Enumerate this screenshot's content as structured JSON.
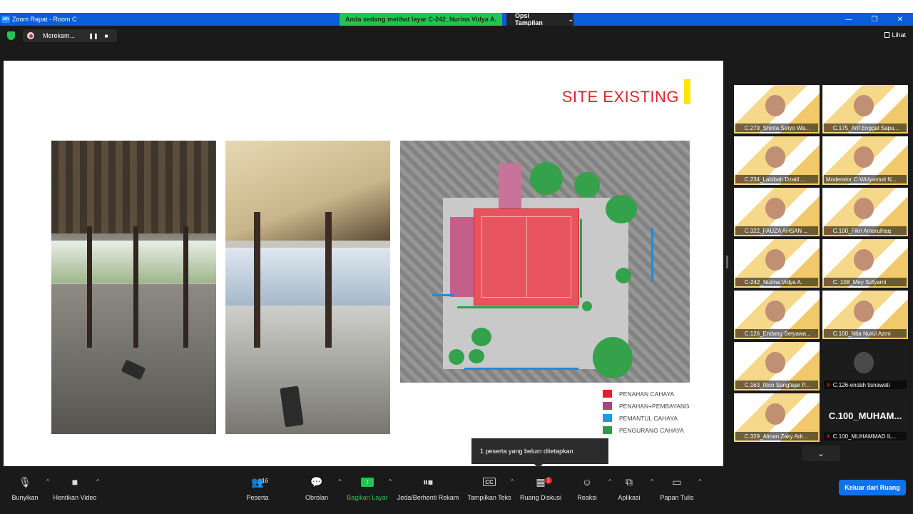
{
  "window": {
    "title": "Zoom Rapat - Room C",
    "logo_text": "zm"
  },
  "share_banner": "Anda sedang melihat layar C-242_Nurina Vidya A.",
  "view_options": {
    "label": "Opsi Tampilan",
    "caret": "⌄"
  },
  "recording": {
    "label": "Merekam...",
    "pause": "❚❚",
    "stop": "■"
  },
  "view_button": "Lihat",
  "slide": {
    "title": "SITE EXISTING",
    "legend": [
      {
        "label": "PENAHAN CAHAYA",
        "color": "#e0202a"
      },
      {
        "label": "PENAHAN+PEMBAYANG",
        "color": "#b0407e"
      },
      {
        "label": "PEMANTUL CAHAYA",
        "color": "#1f9ae0"
      },
      {
        "label": "PENGURANG CAHAYA",
        "color": "#2a9e4a"
      }
    ]
  },
  "participants": [
    {
      "name": "C.279_Shinta Setyo Wa..."
    },
    {
      "name": "C.175_Arif Enggal Sapu..."
    },
    {
      "name": "C.234_Labibah Dzatil ..."
    },
    {
      "name": "Moderator C-Widyastuti N..."
    },
    {
      "name": "C.322_FAUZA AHSAN ..."
    },
    {
      "name": "C.100_Fikri Amarulhaq"
    },
    {
      "name": "C-242_Nurina Vidya A."
    },
    {
      "name": "C. 108_Mey Sofyarni"
    },
    {
      "name": "C.126_Endang Setyawa..."
    },
    {
      "name": "C.100_Nita Nurul Azmi"
    },
    {
      "name": "C.163_Rico Sangfajar P..."
    },
    {
      "name": "C.126-endah tisnawati"
    },
    {
      "name": "C.329_Alman Zaky Adr..."
    },
    {
      "name": "C.100_MUHAMMAD IL...",
      "big_label": "C.100_MUHAM..."
    }
  ],
  "tooltip": "1 peserta yang belum ditetapkan",
  "toolbar": {
    "unmute": "Bunyikan",
    "stop_video": "Hentikan Video",
    "participants": "Peserta",
    "participants_count": "16",
    "chat": "Obrolan",
    "share": "Bagikan Layar",
    "pause_record": "Jeda/Berhenti Rekam",
    "captions": "Tampilkan Teks",
    "captions_icon": "CC",
    "breakout": "Ruang Diskusi",
    "breakout_badge": "1",
    "reactions": "Reaksi",
    "apps": "Aplikasi",
    "whiteboard": "Papan Tulis",
    "leave": "Keluar dari Ruang"
  }
}
